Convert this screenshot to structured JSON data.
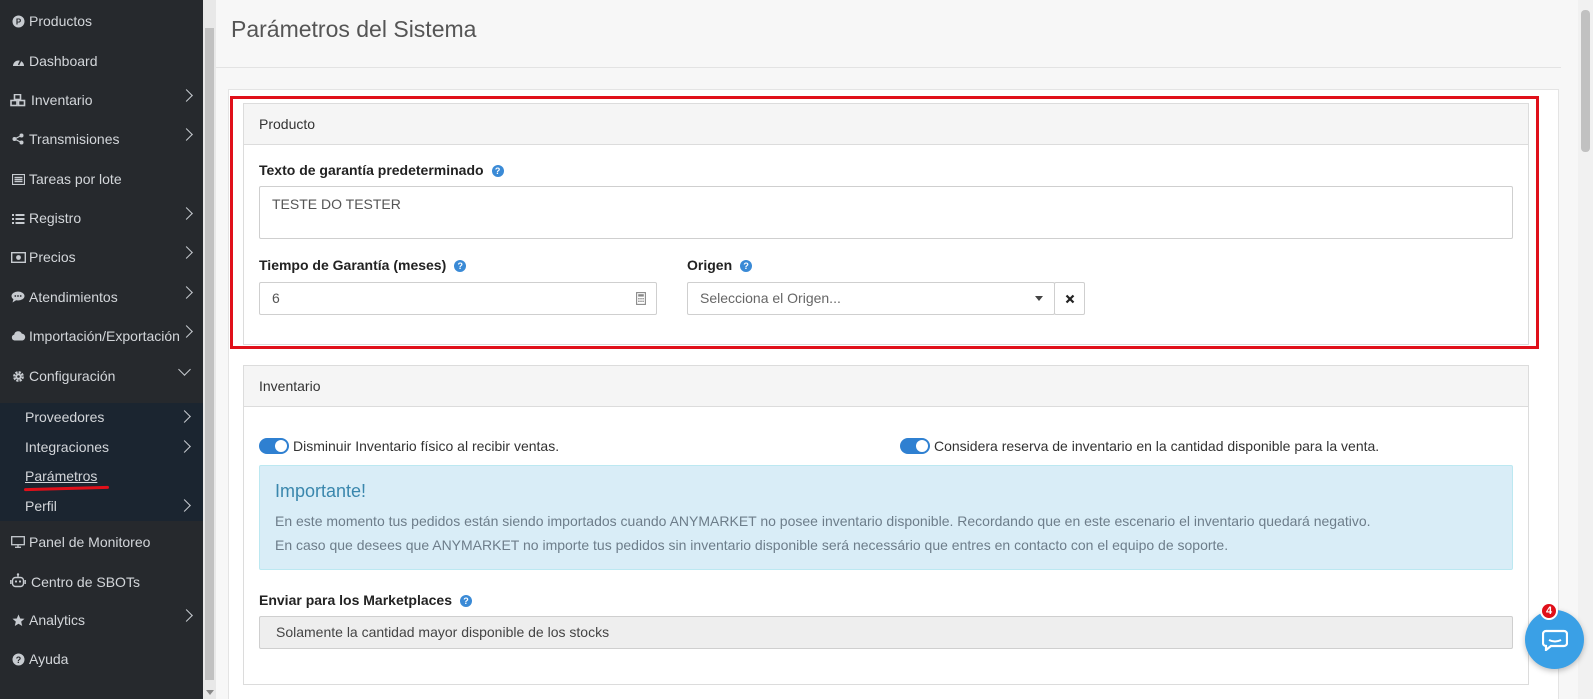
{
  "sidebar": {
    "items": [
      {
        "label": "Productos",
        "icon": "p-circle-icon"
      },
      {
        "label": "Dashboard",
        "icon": "dashboard-icon"
      },
      {
        "label": "Inventario",
        "icon": "cubes-icon"
      },
      {
        "label": "Transmisiones",
        "icon": "share-icon"
      },
      {
        "label": "Tareas por lote",
        "icon": "tasks-icon"
      },
      {
        "label": "Registro",
        "icon": "list-icon"
      },
      {
        "label": "Precios",
        "icon": "money-icon"
      },
      {
        "label": "Atendimientos",
        "icon": "comment-icon"
      },
      {
        "label": "Importación/Exportación",
        "icon": "cloud-icon"
      },
      {
        "label": "Configuración",
        "icon": "gear-icon"
      }
    ],
    "submenu": [
      {
        "label": "Proveedores"
      },
      {
        "label": "Integraciones"
      },
      {
        "label": "Parámetros"
      },
      {
        "label": "Perfil"
      }
    ],
    "items_after": [
      {
        "label": "Panel de Monitoreo",
        "icon": "monitor-icon"
      },
      {
        "label": "Centro de SBOTs",
        "icon": "robot-icon"
      },
      {
        "label": "Analytics",
        "icon": "star-icon"
      },
      {
        "label": "Ayuda",
        "icon": "question-icon"
      }
    ]
  },
  "page": {
    "title": "Parámetros del Sistema"
  },
  "producto": {
    "header": "Producto",
    "warranty_text_label": "Texto de garantía predeterminado",
    "warranty_text_value": "TESTE DO TESTER",
    "warranty_time_label": "Tiempo de Garantía (meses)",
    "warranty_time_value": "6",
    "origin_label": "Origen",
    "origin_placeholder": "Selecciona el Origen..."
  },
  "inventario": {
    "header": "Inventario",
    "toggle1_label": "Disminuir Inventario físico al recibir ventas.",
    "toggle1_on": true,
    "toggle2_label": "Considera reserva de inventario en la cantidad disponible para la venta.",
    "toggle2_on": true,
    "alert_title": "Importante!",
    "alert_line1": "En este momento tus pedidos están siendo importados cuando ANYMARKET no posee inventario disponible. Recordando que en este escenario el inventario quedará negativo.",
    "alert_line2": "En caso que desees que ANYMARKET no importe tus pedidos sin inventario disponible será necessário que entres en contacto con el equipo de soporte.",
    "marketplaces_label": "Enviar para los Marketplaces",
    "marketplaces_value": "Solamente la cantidad mayor disponible de los stocks"
  },
  "chat": {
    "badge": "4"
  },
  "colors": {
    "sidebar_bg": "#26292d",
    "submenu_bg": "#1b2530",
    "highlight_red": "#e0101a",
    "toggle_blue": "#2f80d1",
    "alert_bg": "#d9edf7",
    "chat_blue": "#3aa0e6"
  }
}
